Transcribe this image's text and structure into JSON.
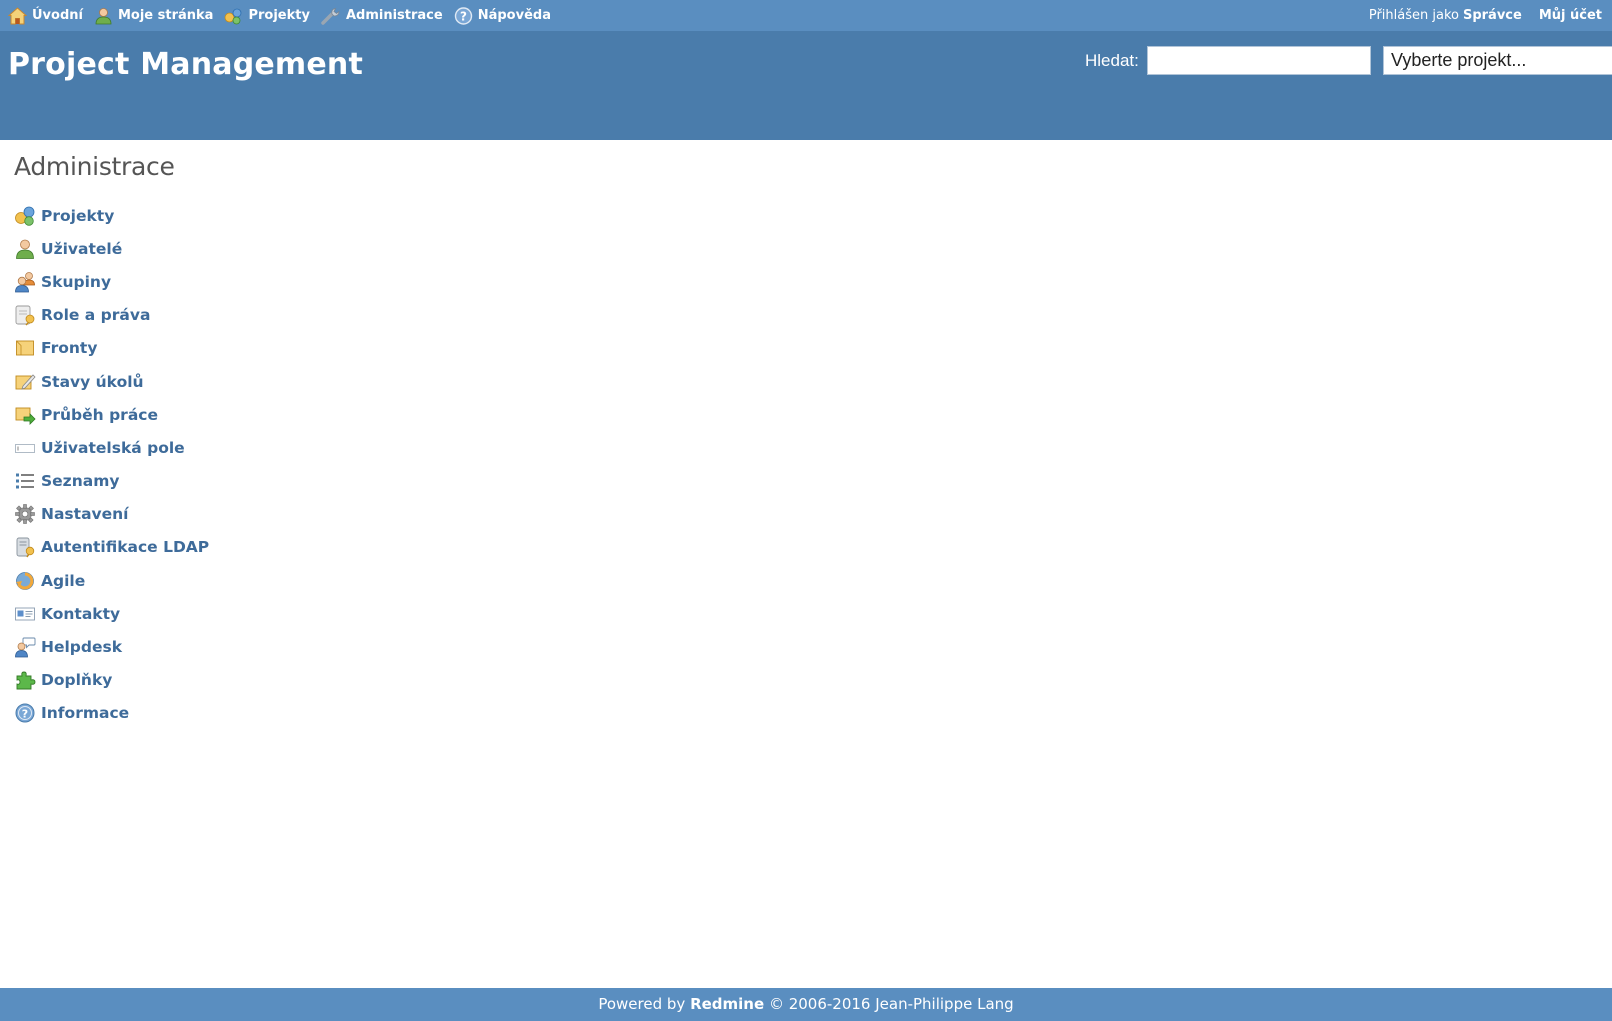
{
  "top_menu": {
    "items": [
      {
        "label": "Úvodní",
        "icon": "home-icon"
      },
      {
        "label": "Moje stránka",
        "icon": "user-icon"
      },
      {
        "label": "Projekty",
        "icon": "projects-icon"
      },
      {
        "label": "Administrace",
        "icon": "wrench-icon"
      },
      {
        "label": "Nápověda",
        "icon": "help-icon"
      }
    ],
    "logged_as_label": "Přihlášen jako",
    "user_name": "Správce",
    "my_account": "Můj účet"
  },
  "header": {
    "title": "Project Management",
    "search_label": "Hledat:",
    "search_value": "",
    "project_jump": "Vyberte projekt..."
  },
  "content": {
    "title": "Administrace",
    "menu": [
      {
        "label": "Projekty",
        "icon": "projects-icon"
      },
      {
        "label": "Uživatelé",
        "icon": "user-icon"
      },
      {
        "label": "Skupiny",
        "icon": "group-icon"
      },
      {
        "label": "Role a práva",
        "icon": "roles-icon"
      },
      {
        "label": "Fronty",
        "icon": "trackers-icon"
      },
      {
        "label": "Stavy úkolů",
        "icon": "issue-statuses-icon"
      },
      {
        "label": "Průběh práce",
        "icon": "workflow-icon"
      },
      {
        "label": "Uživatelská pole",
        "icon": "custom-fields-icon"
      },
      {
        "label": "Seznamy",
        "icon": "list-icon"
      },
      {
        "label": "Nastavení",
        "icon": "gear-icon"
      },
      {
        "label": "Autentifikace LDAP",
        "icon": "ldap-icon"
      },
      {
        "label": "Agile",
        "icon": "agile-icon"
      },
      {
        "label": "Kontakty",
        "icon": "contacts-icon"
      },
      {
        "label": "Helpdesk",
        "icon": "helpdesk-icon"
      },
      {
        "label": "Doplňky",
        "icon": "plugin-icon"
      },
      {
        "label": "Informace",
        "icon": "info-icon"
      }
    ]
  },
  "footer": {
    "prefix": "Powered by",
    "brand": "Redmine",
    "suffix": "© 2006-2016 Jean-Philippe Lang"
  },
  "colors": {
    "top_menu_bg": "#5a8ec0",
    "header_bg": "#4a7cab",
    "link": "#3e6b9a",
    "footer_bg": "#5a8ec0"
  }
}
